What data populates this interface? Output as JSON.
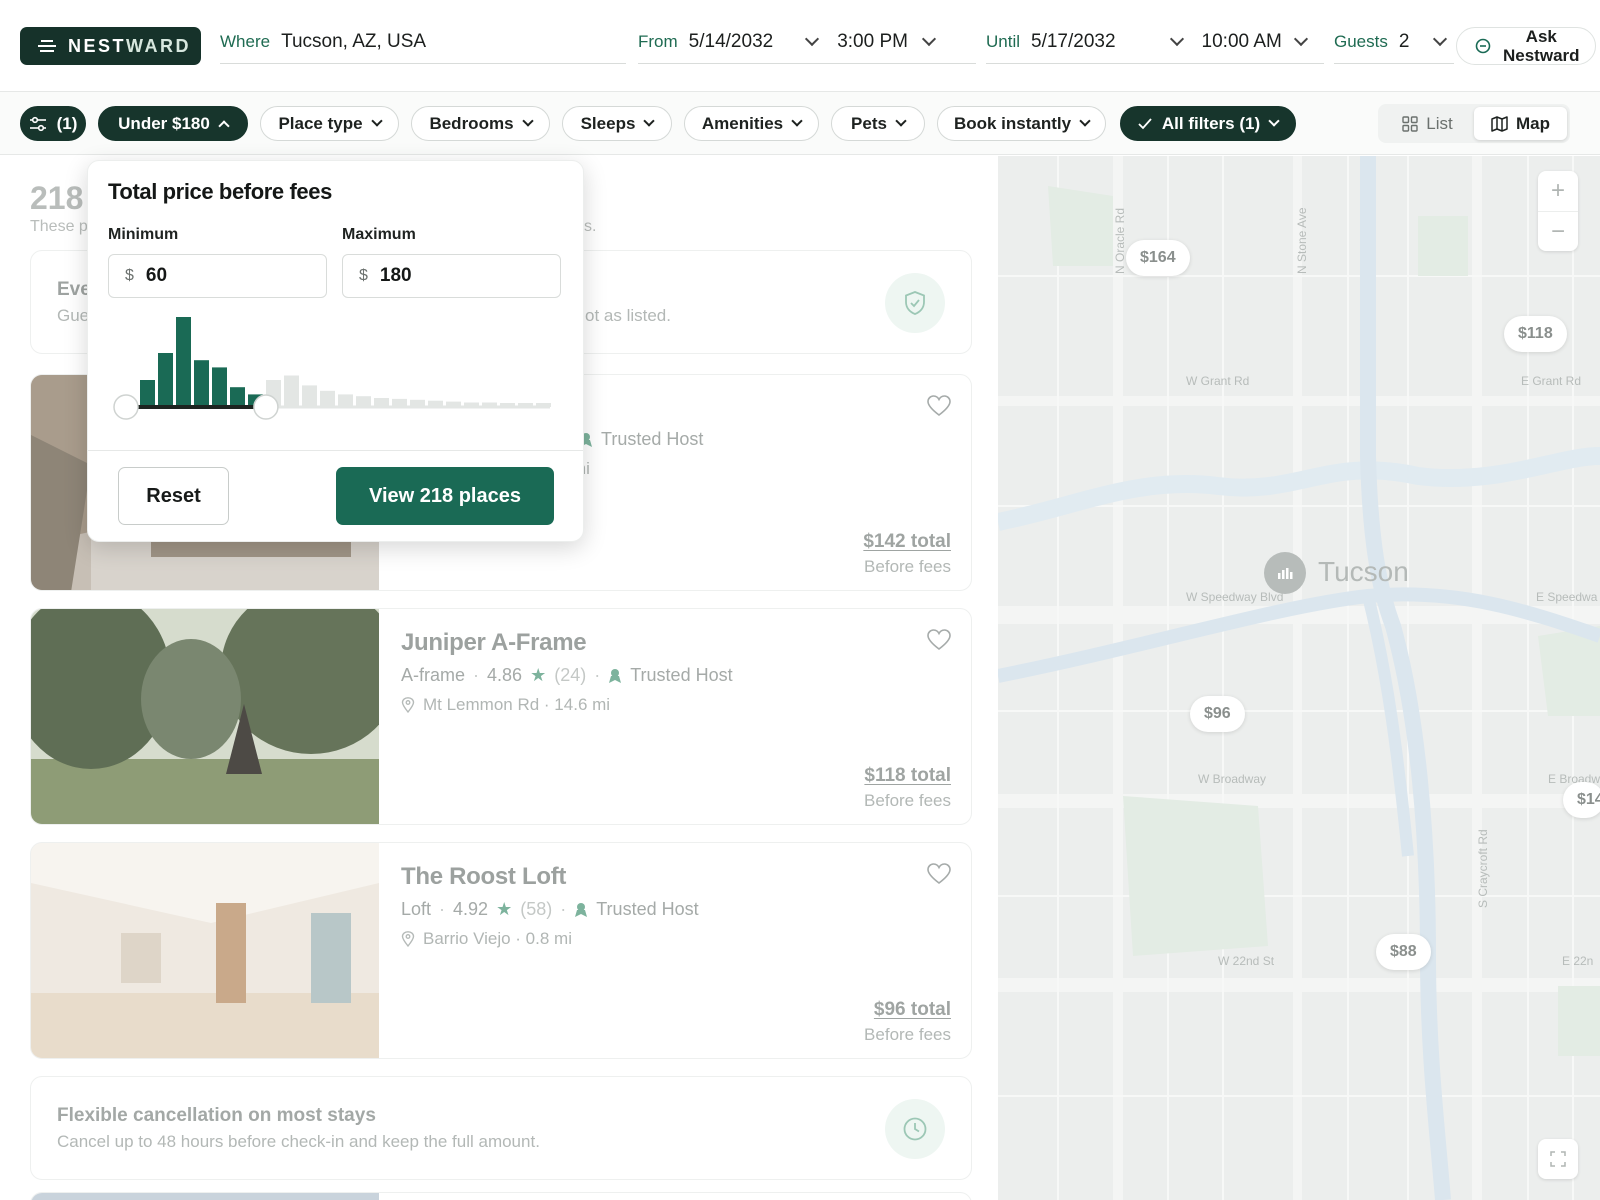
{
  "brand": {
    "name_a": "NEST",
    "name_b": "WARD"
  },
  "search": {
    "where_label": "Where",
    "where_value": "Tucson, AZ, USA",
    "from_label": "From",
    "from_date": "5/14/2032",
    "from_time": "3:00 PM",
    "until_label": "Until",
    "until_date": "5/17/2032",
    "until_time": "10:00 AM",
    "guests_label": "Guests",
    "guests_value": "2",
    "ask_label_1": "Ask",
    "ask_label_2": "Nestward"
  },
  "filters": {
    "filter_count": "(1)",
    "price": "Under $180",
    "place_type": "Place type",
    "bedrooms": "Bedrooms",
    "sleeps": "Sleeps",
    "amenities": "Amenities",
    "pets": "Pets",
    "book_instantly": "Book instantly",
    "all_filters": "All filters (1)",
    "view_list": "List",
    "view_map": "Map"
  },
  "results": {
    "count_title": "218",
    "count_sub": "These p",
    "count_sub_end": "s."
  },
  "info_top": {
    "title": "Eve",
    "sub": "Gue",
    "sub_end": "ot as listed."
  },
  "listings": [
    {
      "name": "",
      "type": "",
      "rating": "",
      "reviews": "",
      "host": "Trusted Host",
      "location": "",
      "distance_tail": "mi",
      "price": "$142 total",
      "fees": "Before fees"
    },
    {
      "name": "Juniper A-Frame",
      "type": "A-frame",
      "rating": "4.86",
      "reviews": "(24)",
      "host": "Trusted Host",
      "location": "Mt Lemmon Rd · 14.6 mi",
      "price": "$118 total",
      "fees": "Before fees"
    },
    {
      "name": "The Roost Loft",
      "type": "Loft",
      "rating": "4.92",
      "reviews": "(58)",
      "host": "Trusted Host",
      "location": "Barrio Viejo · 0.8 mi",
      "price": "$96 total",
      "fees": "Before fees"
    }
  ],
  "info_bottom": {
    "title": "Flexible cancellation on most stays",
    "sub": "Cancel up to 48 hours before check-in and keep the full amount."
  },
  "map": {
    "city": "Tucson",
    "pins": [
      "$164",
      "$118",
      "$96",
      "$88",
      "$14"
    ],
    "streets": {
      "oracle": "N Oracle Rd",
      "stone": "N Stone Ave",
      "w_grant": "W Grant Rd",
      "e_grant": "E Grant Rd",
      "w_speedway": "W Speedway Blvd",
      "e_speedway": "E Speedwa",
      "w_broadway": "W Broadway",
      "e_broadway": "E Broadw",
      "craycroft": "S Craycroft Rd",
      "w_22nd": "W 22nd St",
      "e_22nd": "E 22n"
    },
    "zoom_in": "+",
    "zoom_out": "−"
  },
  "price_popover": {
    "title": "Total price before fees",
    "min_label": "Minimum",
    "max_label": "Maximum",
    "currency": "$",
    "min_value": "60",
    "max_value": "180",
    "histogram_selected": [
      0.3,
      0.6,
      1.0,
      0.52,
      0.44,
      0.22,
      0.14
    ],
    "histogram_unselected": [
      0.3,
      0.35,
      0.24,
      0.18,
      0.14,
      0.12,
      0.1,
      0.09,
      0.08,
      0.07,
      0.06,
      0.05,
      0.05,
      0.04,
      0.04,
      0.04
    ],
    "range_min_fraction": 0.0,
    "range_max_fraction": 0.33,
    "reset_label": "Reset",
    "view_label": "View 218 places"
  },
  "colors": {
    "brand_dark": "#16322a",
    "accent": "#1a6a55",
    "hist_selected": "#1a6a55",
    "hist_unselected": "#e3e6e4"
  }
}
